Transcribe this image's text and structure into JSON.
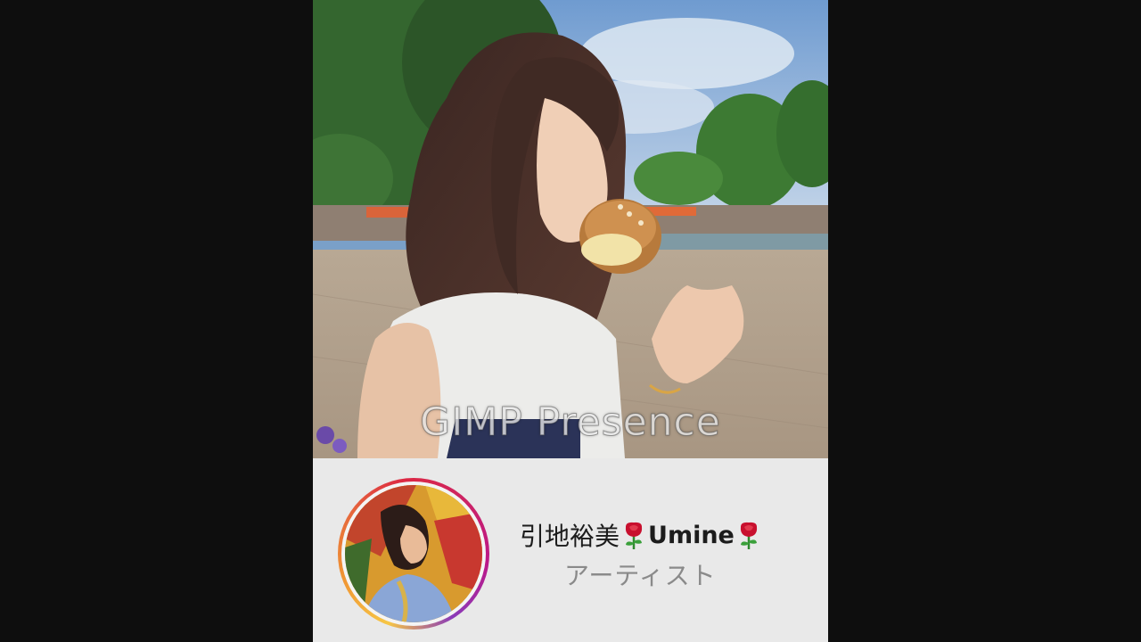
{
  "video": {
    "watermark": "GIMP Presence"
  },
  "profile": {
    "name_jp": "引地裕美",
    "name_latin": "Umine",
    "badge_icon": "rose-emoji",
    "subtitle": "アーティスト"
  },
  "colors": {
    "background": "#0e0e0e",
    "panel": "#e9e9e9",
    "ring_start": "#f6c646",
    "ring_end": "#bc1888",
    "subtitle_text": "#8a8a8a"
  }
}
